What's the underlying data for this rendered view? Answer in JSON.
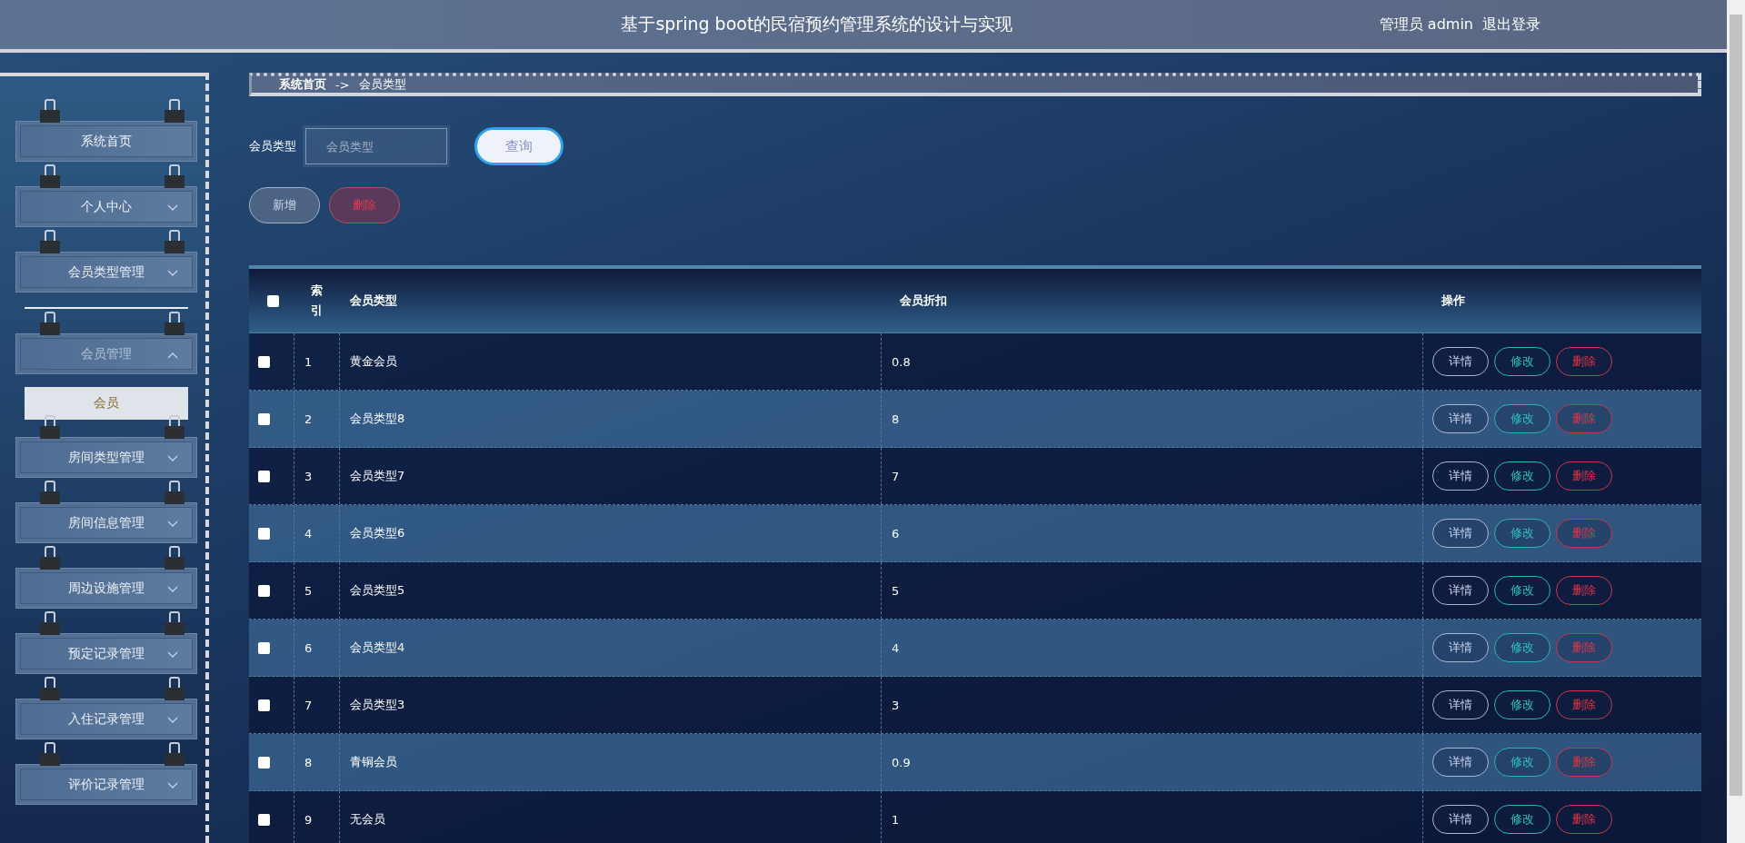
{
  "header": {
    "title": "基于spring boot的民宿预约管理系统的设计与实现",
    "user": "管理员 admin",
    "logout": "退出登录"
  },
  "sidebar": {
    "items": [
      {
        "label": "系统首页"
      },
      {
        "label": "个人中心",
        "expanded": false
      },
      {
        "label": "会员类型管理",
        "expanded": false
      },
      {
        "label": "会员管理",
        "expanded": true,
        "children": [
          {
            "label": "会员",
            "selected": true
          }
        ]
      },
      {
        "label": "房间类型管理",
        "expanded": false
      },
      {
        "label": "房间信息管理",
        "expanded": false
      },
      {
        "label": "周边设施管理",
        "expanded": false
      },
      {
        "label": "预定记录管理",
        "expanded": false
      },
      {
        "label": "入住记录管理",
        "expanded": false
      },
      {
        "label": "评价记录管理",
        "expanded": false
      }
    ]
  },
  "breadcrumb": {
    "home": "系统首页",
    "separator": "->",
    "current": "会员类型"
  },
  "search": {
    "label": "会员类型",
    "placeholder": "会员类型",
    "button": "查询"
  },
  "actions": {
    "add": "新增",
    "delete": "删除"
  },
  "table": {
    "select_all": {
      "checked": false
    },
    "columns": [
      "索引",
      "会员类型",
      "会员折扣",
      "操作"
    ],
    "rows": [
      {
        "checked": false,
        "index": "1",
        "type": "黄金会员",
        "discount": "0.8",
        "actions": [
          "详情",
          "修改",
          "删除"
        ]
      },
      {
        "checked": false,
        "index": "2",
        "type": "会员类型8",
        "discount": "8",
        "actions": [
          "详情",
          "修改",
          "删除"
        ]
      },
      {
        "checked": false,
        "index": "3",
        "type": "会员类型7",
        "discount": "7",
        "actions": [
          "详情",
          "修改",
          "删除"
        ]
      },
      {
        "checked": false,
        "index": "4",
        "type": "会员类型6",
        "discount": "6",
        "actions": [
          "详情",
          "修改",
          "删除"
        ]
      },
      {
        "checked": false,
        "index": "5",
        "type": "会员类型5",
        "discount": "5",
        "actions": [
          "详情",
          "修改",
          "删除"
        ]
      },
      {
        "checked": false,
        "index": "6",
        "type": "会员类型4",
        "discount": "4",
        "actions": [
          "详情",
          "修改",
          "删除"
        ]
      },
      {
        "checked": false,
        "index": "7",
        "type": "会员类型3",
        "discount": "3",
        "actions": [
          "详情",
          "修改",
          "删除"
        ]
      },
      {
        "checked": false,
        "index": "8",
        "type": "青铜会员",
        "discount": "0.9",
        "actions": [
          "详情",
          "修改",
          "删除"
        ]
      },
      {
        "checked": false,
        "index": "9",
        "type": "无会员",
        "discount": "1",
        "actions": [
          "详情",
          "修改",
          "删除"
        ]
      }
    ]
  }
}
